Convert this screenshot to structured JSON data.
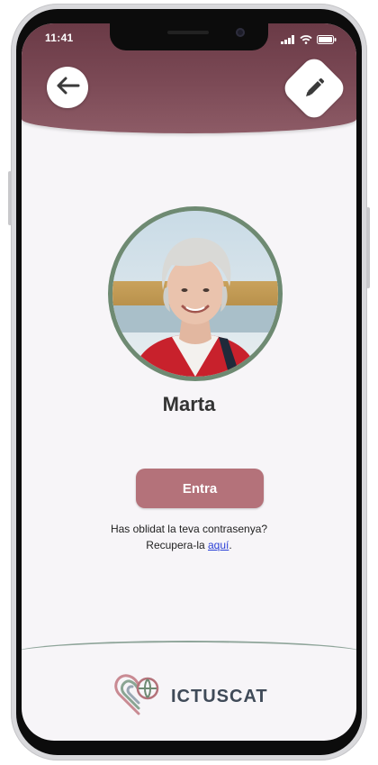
{
  "status_bar": {
    "time": "11:41",
    "icons": [
      "signal-icon",
      "wifi-icon",
      "battery-icon"
    ]
  },
  "header": {
    "back_icon": "arrow-left-icon",
    "edit_icon": "pencil-icon"
  },
  "profile": {
    "name": "Marta",
    "photo": "user-photo"
  },
  "login": {
    "enter_label": "Entra",
    "forgot_line1": "Has oblidat la teva contrasenya?",
    "forgot_prefix": "Recupera-la ",
    "forgot_link": "aquí",
    "forgot_suffix": "."
  },
  "brand": {
    "name": "ICTUSCAT"
  },
  "colors": {
    "header": "#7c4a56",
    "button": "#b4727a",
    "avatar_border": "#6e8a72",
    "link": "#2a3fd6"
  }
}
